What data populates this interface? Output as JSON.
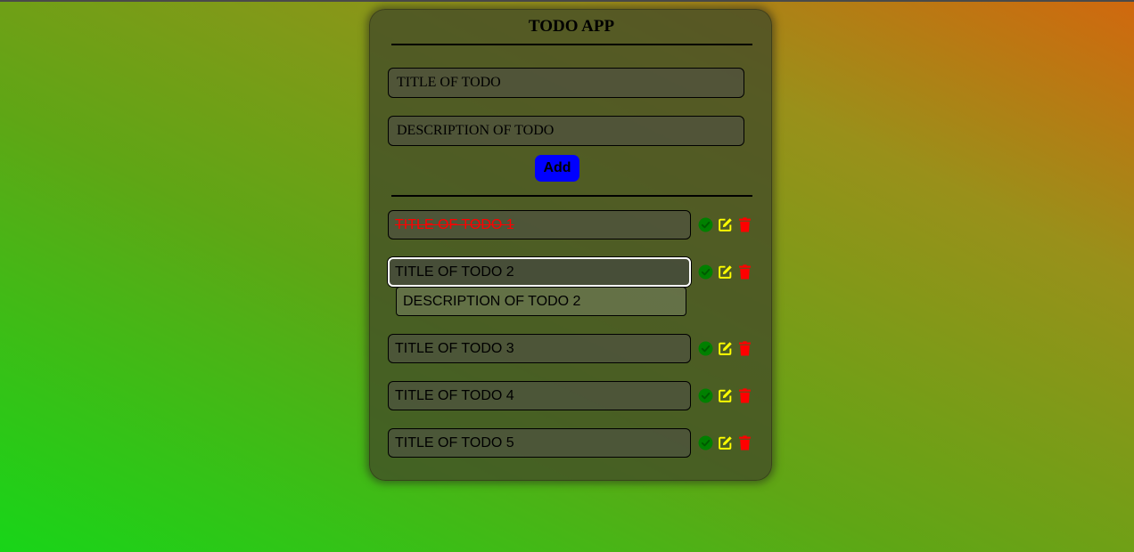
{
  "app": {
    "title": "TODO APP"
  },
  "form": {
    "title_placeholder": "TITLE OF TODO",
    "description_placeholder": "DESCRIPTION OF TODO",
    "add_label": "Add"
  },
  "todos": [
    {
      "title": "TITLE OF TODO 1",
      "completed": true
    },
    {
      "title": "TITLE OF TODO 2",
      "completed": false,
      "expanded": true,
      "description": "DESCRIPTION OF TODO 2"
    },
    {
      "title": "TITLE OF TODO 3",
      "completed": false
    },
    {
      "title": "TITLE OF TODO 4",
      "completed": false
    },
    {
      "title": "TITLE OF TODO 5",
      "completed": false
    }
  ],
  "icons": {
    "complete": "check-circle-icon",
    "edit": "edit-icon",
    "delete": "trash-icon"
  },
  "colors": {
    "add_button": "#0000ff",
    "complete_icon": "#008000",
    "edit_icon": "#ffff00",
    "delete_icon": "#ff0000",
    "completed_text": "#ff0000"
  }
}
